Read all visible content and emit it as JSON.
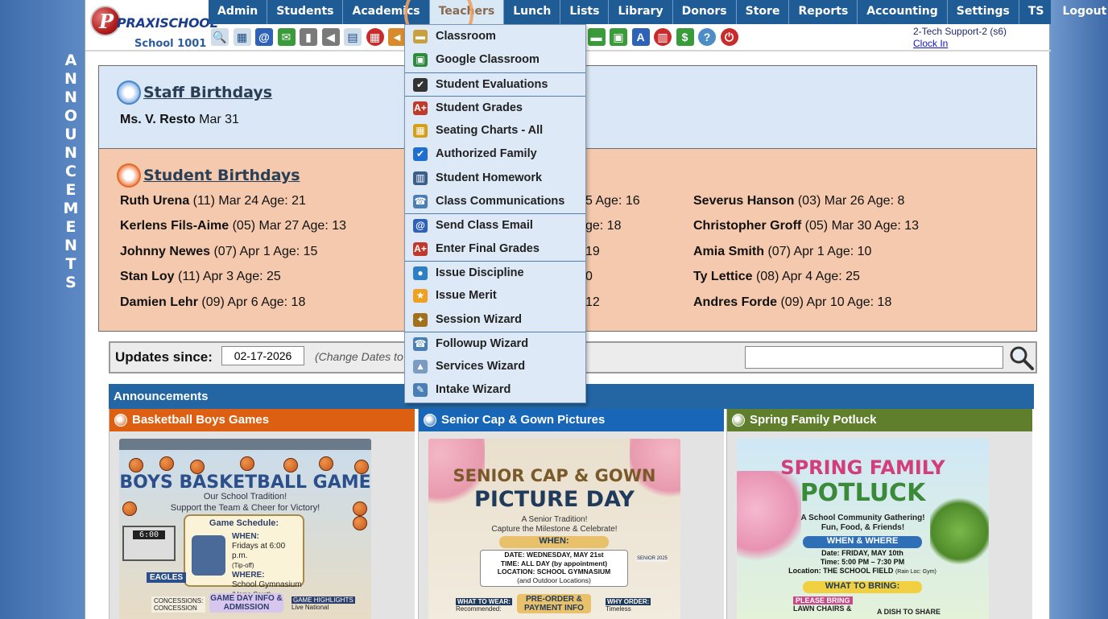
{
  "logo": {
    "brand": "PRAXISCHOOL",
    "tm": "™",
    "school": "School 1001",
    "initial": "P"
  },
  "side_banner": [
    "A",
    "N",
    "N",
    "O",
    "U",
    "N",
    "C",
    "E",
    "M",
    "E",
    "N",
    "T",
    "S"
  ],
  "nav": [
    {
      "label": "Admin",
      "name": "nav-admin"
    },
    {
      "label": "Students",
      "name": "nav-students"
    },
    {
      "label": "Academics",
      "name": "nav-academics"
    },
    {
      "label": "Teachers",
      "name": "nav-teachers",
      "active": true
    },
    {
      "label": "Lunch",
      "name": "nav-lunch"
    },
    {
      "label": "Lists",
      "name": "nav-lists"
    },
    {
      "label": "Library",
      "name": "nav-library"
    },
    {
      "label": "Donors",
      "name": "nav-donors"
    },
    {
      "label": "Store",
      "name": "nav-store"
    },
    {
      "label": "Reports",
      "name": "nav-reports"
    },
    {
      "label": "Accounting",
      "name": "nav-accounting"
    },
    {
      "label": "Settings",
      "name": "nav-settings"
    },
    {
      "label": "TS",
      "name": "nav-ts"
    },
    {
      "label": "Logout",
      "name": "nav-logout"
    }
  ],
  "toolbar_icons": [
    {
      "name": "search-icon",
      "glyph": "🔍",
      "style": "t-light"
    },
    {
      "name": "grid-icon",
      "glyph": "▦",
      "style": "t-light"
    },
    {
      "name": "email-icon",
      "glyph": "@",
      "style": "t-blue"
    },
    {
      "name": "chat-icon",
      "glyph": "✉",
      "style": "t-green"
    },
    {
      "name": "phone-icon",
      "glyph": "▮",
      "style": "t-grey"
    },
    {
      "name": "speaker-icon",
      "glyph": "◀",
      "style": "t-grey"
    },
    {
      "name": "report-icon",
      "glyph": "▤",
      "style": "t-light"
    },
    {
      "name": "calendar-icon",
      "glyph": "▦",
      "style": "t-red"
    },
    {
      "name": "megaphone-icon",
      "glyph": "◄",
      "style": "t-orange"
    },
    {
      "name": "folder-icon",
      "glyph": "■",
      "style": "t-light"
    },
    {
      "name": "book-icon",
      "glyph": "▥",
      "style": "t-light"
    },
    {
      "name": "chart-icon",
      "glyph": "▤",
      "style": "t-light"
    },
    {
      "name": "user-icon",
      "glyph": "●",
      "style": "t-light"
    },
    {
      "name": "arrow-right-icon",
      "glyph": "➜",
      "style": "t-green"
    },
    {
      "name": "person-icon",
      "glyph": "●",
      "style": "t-grey"
    },
    {
      "name": "clock-icon",
      "glyph": "◷",
      "style": "t-teal"
    },
    {
      "name": "table-icon",
      "glyph": "▦",
      "style": "t-light"
    },
    {
      "name": "ticket-icon",
      "glyph": "▬",
      "style": "t-green"
    },
    {
      "name": "printer-icon",
      "glyph": "▣",
      "style": "t-green"
    },
    {
      "name": "ap-icon",
      "glyph": "A",
      "style": "t-blue"
    },
    {
      "name": "pdf-icon",
      "glyph": "▥",
      "style": "t-red"
    },
    {
      "name": "money-icon",
      "glyph": "$",
      "style": "t-green"
    },
    {
      "name": "help-icon",
      "glyph": "?",
      "style": "t-teal"
    },
    {
      "name": "power-icon",
      "glyph": "⏻",
      "style": "t-red"
    }
  ],
  "user": {
    "name": "2-Tech Support-2 (s6)",
    "clock_in": "Clock In"
  },
  "staff_birthdays": {
    "title": "Staff Birthdays",
    "entries": [
      {
        "name": "Ms. V. Resto",
        "detail": " Mar 31"
      }
    ]
  },
  "student_birthdays": {
    "title": "Student Birthdays",
    "columns": [
      [
        {
          "name": "Ruth Urena",
          "detail": " (11) Mar 24 Age: 21"
        },
        {
          "name": "Kerlens Fils-Aime",
          "detail": " (05) Mar 27 Age: 13"
        },
        {
          "name": "Johnny Newes",
          "detail": " (07) Apr 1 Age: 15"
        },
        {
          "name": "Stan Loy",
          "detail": " (11) Apr 3 Age: 25"
        },
        {
          "name": "Damien Lehr",
          "detail": " (09) Apr 6 Age: 18"
        }
      ],
      [
        {
          "name": "",
          "detail": "5 Age: 16"
        },
        {
          "name": "",
          "detail": "ge: 18"
        },
        {
          "name": "",
          "detail": "19"
        },
        {
          "name": "",
          "detail": "0"
        },
        {
          "name": "",
          "detail": "12"
        }
      ],
      [
        {
          "name": "Severus Hanson",
          "detail": " (03) Mar 26 Age: 8"
        },
        {
          "name": "Christopher Groff",
          "detail": " (05) Mar 30 Age: 13"
        },
        {
          "name": "Amia Smith",
          "detail": " (07) Apr 1 Age: 10"
        },
        {
          "name": "Ty Lettice",
          "detail": " (08) Apr 4 Age: 25"
        },
        {
          "name": "Andres Forde",
          "detail": " (09) Apr 10 Age: 18"
        }
      ]
    ]
  },
  "updates": {
    "label": "Updates since:",
    "date": "02-17-2026",
    "hint": "(Change Dates to s",
    "search_value": ""
  },
  "announcements": {
    "header": "Announcements",
    "cards": [
      {
        "title": "Basketball Boys Games",
        "color": "#dc5f12",
        "poster": {
          "headline": "BOYS BASKETBALL GAME",
          "sub1": "Our School Tradition!",
          "sub2": "Support the Team & Cheer for Victory!",
          "box_title": "Game Schedule:",
          "when_label": "WHEN:",
          "when": "Fridays at 6:00 p.m.",
          "when_note": "(Tip-off)",
          "where_label": "WHERE:",
          "where": "School Gymnasium",
          "where_note": "(Home Court)",
          "scoreboard": "6:00",
          "banner": "EAGLES",
          "bottom_left": "CONCESSIONS:",
          "bottom_left_2": "CONCESSION",
          "bottom_mid": "GAME DAY INFO & ADMISSION",
          "bottom_right": "GAME HIGHLIGHTS",
          "bottom_right_2": "Live National"
        }
      },
      {
        "title": "Senior Cap & Gown Pictures",
        "color": "#1766b8",
        "poster": {
          "headline": "SENIOR CAP & GOWN",
          "headline2": "PICTURE DAY",
          "sub1": "A Senior Tradition!",
          "sub2": "Capture the Milestone & Celebrate!",
          "when_label": "WHEN:",
          "line1": "DATE: WEDNESDAY, MAY 21st",
          "line2": "TIME: ALL DAY (by appointment)",
          "line3": "LOCATION: SCHOOL GYMNASIUM",
          "line4": "(and Outdoor Locations)",
          "badge": "SENIOR 2025",
          "bottom_left": "WHAT TO WEAR:",
          "bottom_left_2": "Recommended:",
          "bottom_mid": "PRE-ORDER & PAYMENT INFO",
          "bottom_right": "WHY ORDER:",
          "bottom_right_2": "Timeless"
        }
      },
      {
        "title": "Spring Family Potluck",
        "color": "#5f7f2c",
        "poster": {
          "headline": "SPRING FAMILY",
          "headline2": "POTLUCK",
          "sub1": "A School Community Gathering!",
          "sub2": "Fun, Food, & Friends!",
          "when_label": "WHEN & WHERE",
          "line1": "Date: FRIDAY, MAY 10th",
          "line2": "Time: 5:00 PM – 7:30 PM",
          "line3": "Location: THE SCHOOL FIELD",
          "line3b": "(Rain Loc: Gym)",
          "bring_label": "WHAT TO BRING:",
          "bottom_left": "PLEASE BRING",
          "bottom_left_2": "LAWN CHAIRS &",
          "bottom_right": "A DISH TO SHARE"
        }
      }
    ]
  },
  "teachers_menu": [
    {
      "label": "Classroom",
      "icon": "classroom-icon",
      "glyph": "▬",
      "color": "#c8a040",
      "sep": false
    },
    {
      "label": "Google Classroom",
      "icon": "google-classroom-icon",
      "glyph": "▣",
      "color": "#2e8b3e",
      "sep": false
    },
    {
      "label": "Student Evaluations",
      "icon": "checkbox-icon",
      "glyph": "✔",
      "color": "#333333",
      "sep": true
    },
    {
      "label": "Student Grades",
      "icon": "grade-a-plus-icon",
      "glyph": "A+",
      "color": "#c0392b",
      "sep": true
    },
    {
      "label": "Seating Charts - All",
      "icon": "seating-chart-icon",
      "glyph": "▦",
      "color": "#d4a017",
      "sep": false
    },
    {
      "label": "Authorized Family",
      "icon": "checkmark-icon",
      "glyph": "✔",
      "color": "#1f6fd0",
      "sep": false
    },
    {
      "label": "Student Homework",
      "icon": "book-icon",
      "glyph": "▥",
      "color": "#3b5f8c",
      "sep": false
    },
    {
      "label": "Class Communications",
      "icon": "phone-book-icon",
      "glyph": "☎",
      "color": "#4a7fb5",
      "sep": false
    },
    {
      "label": "Send Class Email",
      "icon": "at-sign-icon",
      "glyph": "@",
      "color": "#2d62b8",
      "sep": true
    },
    {
      "label": "Enter Final Grades",
      "icon": "grade-a-plus-icon",
      "glyph": "A+",
      "color": "#c0392b",
      "sep": false
    },
    {
      "label": "Issue Discipline",
      "icon": "lightbulb-icon",
      "glyph": "●",
      "color": "#2f7fc5",
      "sep": true
    },
    {
      "label": "Issue Merit",
      "icon": "star-icon",
      "glyph": "★",
      "color": "#f0a020",
      "sep": false
    },
    {
      "label": "Session Wizard",
      "icon": "wizard-icon",
      "glyph": "✦",
      "color": "#a0701a",
      "sep": false
    },
    {
      "label": "Followup Wizard",
      "icon": "followup-icon",
      "glyph": "☎",
      "color": "#4a7fb5",
      "sep": true
    },
    {
      "label": "Services Wizard",
      "icon": "services-icon",
      "glyph": "▲",
      "color": "#7a9cc0",
      "sep": false
    },
    {
      "label": "Intake Wizard",
      "icon": "intake-icon",
      "glyph": "✎",
      "color": "#4a7fb5",
      "sep": false
    }
  ]
}
